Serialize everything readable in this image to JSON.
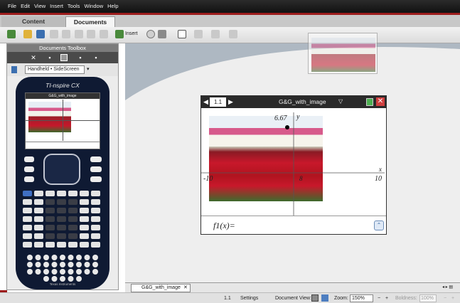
{
  "menu": [
    "File",
    "Edit",
    "View",
    "Insert",
    "Tools",
    "Window",
    "Help"
  ],
  "tabs": {
    "content": "Content",
    "documents": "Documents"
  },
  "toolbar": {
    "insert_label": "Insert"
  },
  "toolbox": {
    "title": "Documents Toolbox",
    "handheld_mode": "Handheld • SideScreen"
  },
  "handheld": {
    "brand": "TI-nspire CX",
    "footer": "Texas Instruments",
    "screen_title": "G&G_with_image"
  },
  "document": {
    "page_id": "1.1",
    "name": "G&G_with_image",
    "point_label": "6.67",
    "y_label": "y",
    "x_label": "x",
    "x_min_label": "-10",
    "x_max_label": "10",
    "tick_label": "8",
    "function_entry": "f1(x)="
  },
  "doc_tab": "G&G_with_image",
  "status": {
    "page": "1.1",
    "settings": "Settings",
    "document_view": "Document View:",
    "zoom_label": "Zoom:",
    "zoom_value": "150%",
    "boldness_label": "Boldness:",
    "boldness_value": "100%"
  },
  "colors": {
    "accent": "#9c1c1c",
    "menubar": "#1c1c1c",
    "workspace": "#aeb8c2",
    "device": "#0f1a33"
  }
}
